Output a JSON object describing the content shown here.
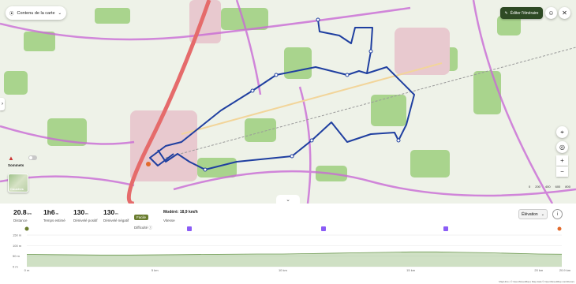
{
  "map": {
    "layers_label": "Contenu de la carte",
    "edit_label": "Éditer l'itinéraire",
    "peaks_label": "Sommets",
    "layer_thumb_label": "Couches",
    "scale_ticks": [
      "0",
      "200",
      "400",
      "600",
      "800"
    ],
    "attribution": "MapLibre | © OpenStreetMap | Map data © OpenStreetMap contributors",
    "colors": {
      "route": "#1f3fa0",
      "roads": "#c96bd6",
      "main_road": "#e56b6b",
      "forest": "#8cc46c",
      "urban": "#e8c9cf"
    }
  },
  "stats": {
    "distance": {
      "value": "20.8",
      "unit": "km",
      "label": "Distance"
    },
    "time": {
      "value": "1h6",
      "unit": "m",
      "label": "Temps estimé"
    },
    "ascent": {
      "value": "130",
      "unit": "m",
      "label": "Dénivelé positif"
    },
    "descent": {
      "value": "130",
      "unit": "m",
      "label": "Dénivelé négatif"
    },
    "difficulty": {
      "value": "Facile",
      "label": "Difficulté ⓘ"
    },
    "speed": {
      "value": "Modéré: 18,9 km/h",
      "label": "Vitesse"
    },
    "elevation_button": "Élévation"
  },
  "chart_data": {
    "type": "area",
    "ylabel": "",
    "yticks": [
      "150 m",
      "100 m",
      "50 m",
      "0 m"
    ],
    "xticks": [
      "0 m",
      "5 km",
      "10 km",
      "15 km",
      "20 km",
      "20.9 km"
    ],
    "ylim": [
      0,
      150
    ],
    "xlim": [
      0,
      20.9
    ],
    "x": [
      0,
      1,
      2,
      3,
      4,
      5,
      6,
      7,
      8,
      9,
      10,
      11,
      12,
      13,
      14,
      15,
      16,
      17,
      18,
      19,
      20,
      20.9
    ],
    "y": [
      58,
      57,
      56,
      55,
      55,
      56,
      57,
      58,
      59,
      60,
      60,
      62,
      64,
      66,
      68,
      70,
      70,
      68,
      66,
      63,
      60,
      59
    ],
    "color": "#9fc28a"
  }
}
